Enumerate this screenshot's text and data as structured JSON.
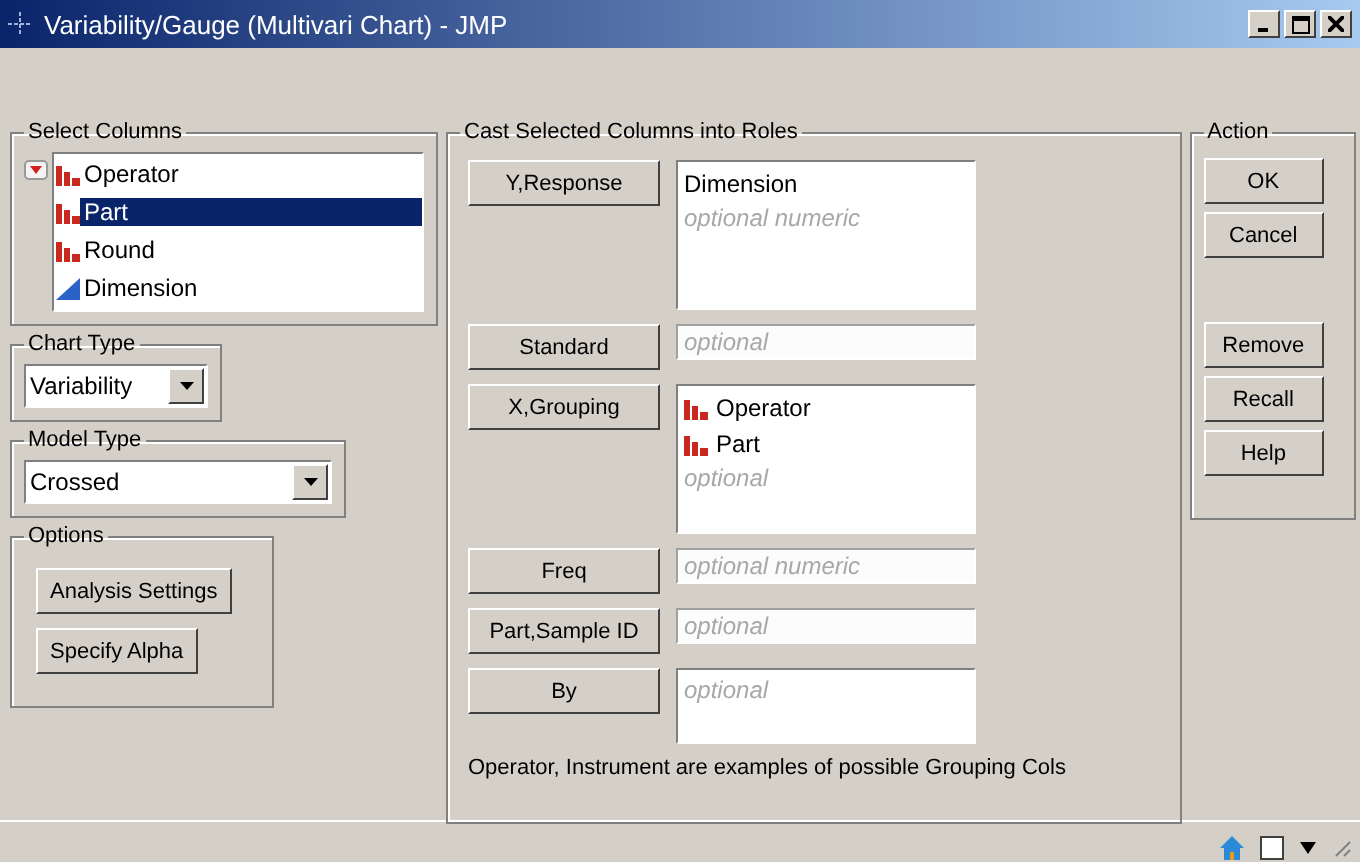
{
  "window": {
    "title": "Variability/Gauge (Multivari Chart) - JMP"
  },
  "select_columns": {
    "label": "Select Columns",
    "columns": [
      {
        "name": "Operator",
        "kind": "nominal",
        "selected": false
      },
      {
        "name": "Part",
        "kind": "nominal",
        "selected": true
      },
      {
        "name": "Round",
        "kind": "nominal",
        "selected": false
      },
      {
        "name": "Dimension",
        "kind": "continuous",
        "selected": false
      }
    ]
  },
  "chart_type": {
    "label": "Chart Type",
    "value": "Variability"
  },
  "model_type": {
    "label": "Model Type",
    "value": "Crossed"
  },
  "options": {
    "label": "Options",
    "buttons": [
      "Analysis Settings",
      "Specify Alpha"
    ]
  },
  "roles": {
    "label": "Cast Selected Columns into Roles",
    "rows": [
      {
        "button": "Y,Response",
        "kind": "list",
        "items": [
          {
            "name": "Dimension",
            "kind": "plain"
          }
        ],
        "placeholder": "optional numeric"
      },
      {
        "button": "Standard",
        "kind": "field",
        "placeholder": "optional"
      },
      {
        "button": "X,Grouping",
        "kind": "list",
        "items": [
          {
            "name": "Operator",
            "kind": "nominal"
          },
          {
            "name": "Part",
            "kind": "nominal"
          }
        ],
        "placeholder": "optional"
      },
      {
        "button": "Freq",
        "kind": "field",
        "placeholder": "optional numeric"
      },
      {
        "button": "Part,Sample ID",
        "kind": "field",
        "placeholder": "optional"
      },
      {
        "button": "By",
        "kind": "list",
        "items": [],
        "placeholder": "optional"
      }
    ],
    "note": "Operator, Instrument are examples of possible Grouping Cols"
  },
  "action": {
    "label": "Action",
    "buttons": [
      "OK",
      "Cancel",
      "Remove",
      "Recall",
      "Help"
    ]
  }
}
